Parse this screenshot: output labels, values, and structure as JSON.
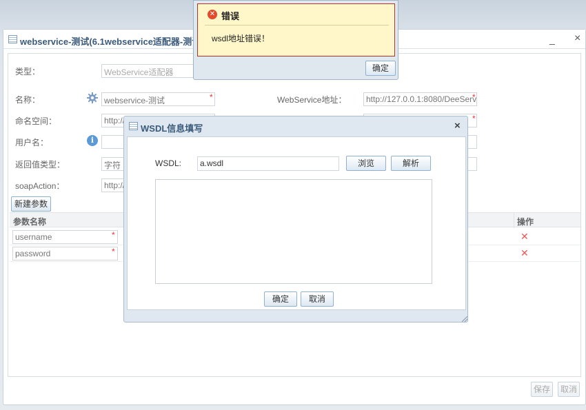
{
  "main_window": {
    "title": "webservice-测试(6.1webservice适配器-测试)",
    "minimize_symbol": "_",
    "close_symbol": "×"
  },
  "form": {
    "type_label": "类型：",
    "type_value": "WebService适配器",
    "name_label": "名称：",
    "name_value": "webservice-测试",
    "namespace_label": "命名空间：",
    "namespace_value": "http://",
    "username_label": "用户名：",
    "return_type_label": "返回值类型：",
    "return_type_value": "字符",
    "soap_action_label": "soapAction：",
    "soap_action_value": "http://",
    "ws_address_label": "WebService地址：",
    "ws_address_value": "http://127.0.0.1:8080/DeeServ",
    "required_mark": "*",
    "info_symbol": "i",
    "gear_icon": "gear-icon",
    "info_icon": "info-icon"
  },
  "params": {
    "new_button": "新建参数",
    "col_name": "参数名称",
    "col_op": "操作",
    "rows": [
      {
        "name": "username",
        "delete_symbol": "✕"
      },
      {
        "name": "password",
        "delete_symbol": "✕"
      }
    ]
  },
  "footer": {
    "save_button": "保存",
    "cancel_button": "取消"
  },
  "error_dialog": {
    "title": "错误",
    "icon_symbol": "✕",
    "message": "wsdl地址错误！",
    "ok_button": "确定"
  },
  "wsdl_dialog": {
    "title": "WSDL信息填写",
    "close_symbol": "×",
    "wsdl_label": "WSDL:",
    "wsdl_value": "a.wsdl",
    "browse_button": "浏览",
    "parse_button": "解析",
    "ok_button": "确定",
    "cancel_button": "取消"
  },
  "colors": {
    "title_text": "#3b5a7a",
    "error_border": "#b5322a",
    "error_bg": "#fff7c9",
    "required": "#e33",
    "delete": "#e55"
  }
}
